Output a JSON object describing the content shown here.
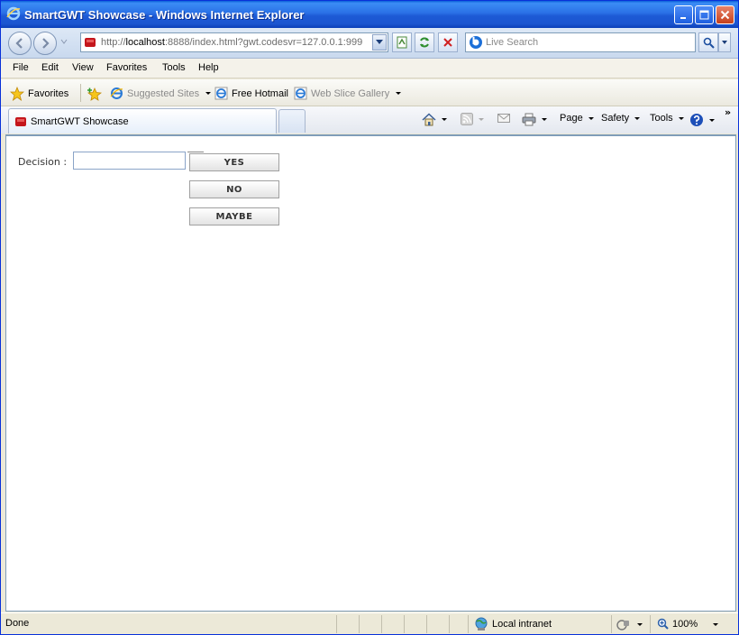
{
  "window": {
    "title": "SmartGWT Showcase - Windows Internet Explorer"
  },
  "address": {
    "protocol": "http://",
    "host": "localhost",
    "rest": ":8888/index.html?gwt.codesvr=127.0.0.1:999"
  },
  "search": {
    "placeholder": "Live Search"
  },
  "menu": {
    "file": "File",
    "edit": "Edit",
    "view": "View",
    "favorites": "Favorites",
    "tools": "Tools",
    "help": "Help"
  },
  "favbar": {
    "favorites": "Favorites",
    "suggested_sites": "Suggested Sites",
    "free_hotmail": "Free Hotmail",
    "web_slice_gallery": "Web Slice Gallery"
  },
  "tab": {
    "label": "SmartGWT Showcase"
  },
  "commands": {
    "page": "Page",
    "safety": "Safety",
    "tools": "Tools"
  },
  "form": {
    "decision_label": "Decision :",
    "decision_value": "",
    "yes": "YES",
    "no": "NO",
    "maybe": "MAYBE"
  },
  "status": {
    "text": "Done",
    "zone": "Local intranet",
    "zoom": "100%"
  },
  "colors": {
    "titlebar": "#2a70e6",
    "close_button": "#c6401c"
  }
}
